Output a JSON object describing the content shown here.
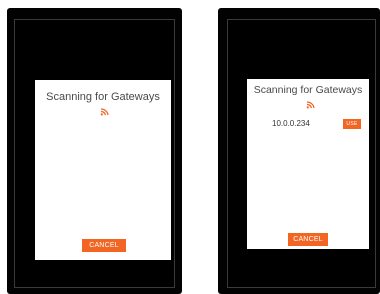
{
  "accent_color": "#f26522",
  "screens": [
    {
      "dialog": {
        "title": "Scanning for Gateways",
        "icon": "wifi-signal-icon",
        "cancel_label": "CANCEL"
      }
    },
    {
      "dialog": {
        "title": "Scanning for Gateways",
        "icon": "wifi-signal-icon",
        "gateways": [
          {
            "ip": "10.0.0.234",
            "action_label": "USE"
          }
        ],
        "cancel_label": "CANCEL"
      }
    }
  ]
}
